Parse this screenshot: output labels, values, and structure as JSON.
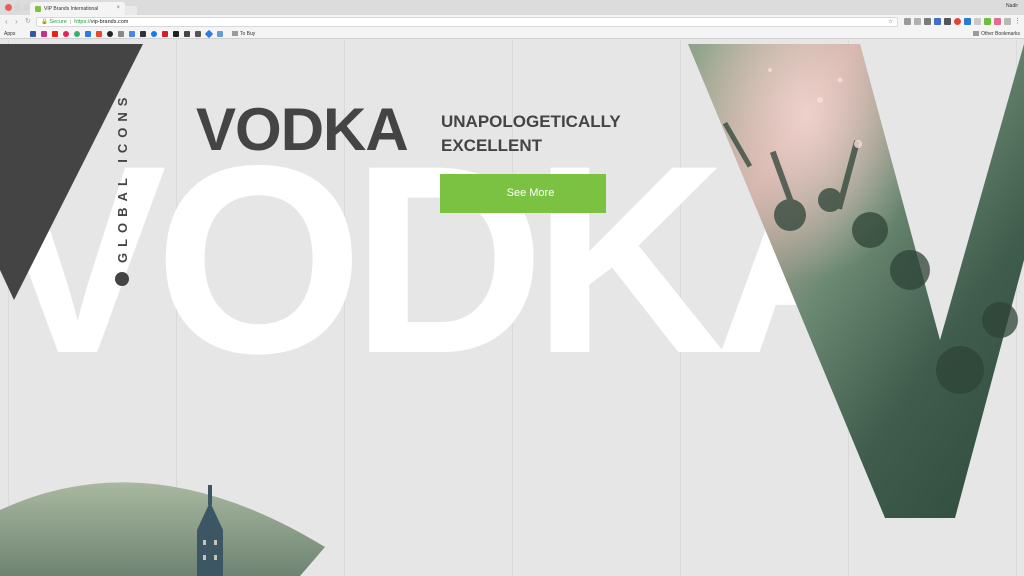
{
  "browser": {
    "tab_title": "VIP Brands International",
    "tab_close": "×",
    "user_name": "Nadir",
    "secure_label": "Secure",
    "url_scheme": "https://",
    "url_host": "vip-brands.com",
    "bookmark_apps": "Apps",
    "bookmark_folder": "To Buy",
    "bookmark_other": "Other Bookmarks",
    "colors": {
      "secure": "#1e9e3a",
      "tab_favicon": "#7dc242"
    }
  },
  "hero": {
    "background_word": "VODKA",
    "vertical_label": "GLOBAL ICONS",
    "title": "VODKA",
    "tagline_line1": "UNAPOLOGETICALLY",
    "tagline_line2": "EXCELLENT",
    "cta_label": "See More",
    "colors": {
      "accent": "#7cc242",
      "text_dark": "#444444",
      "background": "#e6e6e6"
    }
  }
}
